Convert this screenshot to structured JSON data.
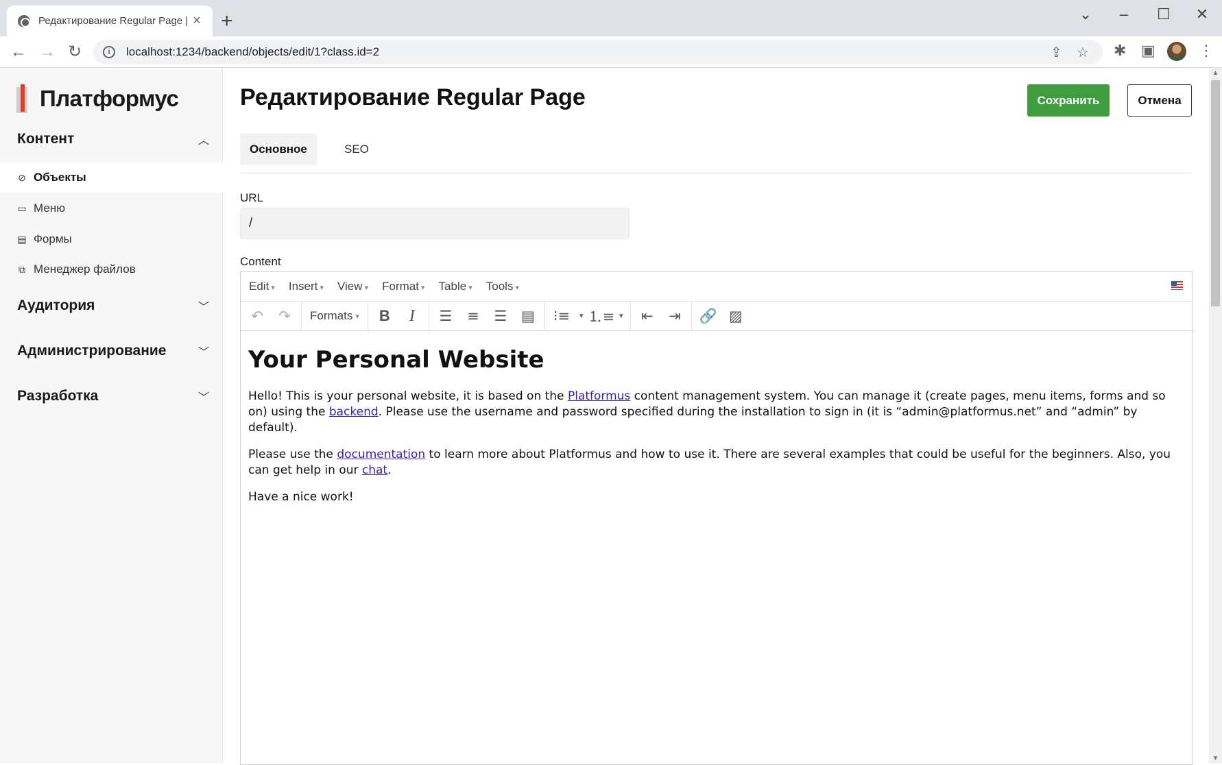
{
  "browser": {
    "tab_title": "Редактирование Regular Page | Пл",
    "url": "localhost:1234/backend/objects/edit/1?class.id=2"
  },
  "sidebar": {
    "logo_text": "Платформус",
    "sections": [
      {
        "label": "Контент",
        "expanded": true
      },
      {
        "label": "Аудитория",
        "expanded": false
      },
      {
        "label": "Администрирование",
        "expanded": false
      },
      {
        "label": "Разработка",
        "expanded": false
      }
    ],
    "content_items": [
      {
        "label": "Объекты",
        "icon": "tag-icon",
        "active": true
      },
      {
        "label": "Меню",
        "icon": "menu-icon",
        "active": false
      },
      {
        "label": "Формы",
        "icon": "form-icon",
        "active": false
      },
      {
        "label": "Менеджер файлов",
        "icon": "files-icon",
        "active": false
      }
    ]
  },
  "main": {
    "title": "Редактирование Regular Page",
    "save_label": "Сохранить",
    "cancel_label": "Отмена",
    "tabs": [
      {
        "label": "Основное",
        "active": true
      },
      {
        "label": "SEO",
        "active": false
      }
    ],
    "url_label": "URL",
    "url_value": "/",
    "content_label": "Content"
  },
  "editor": {
    "menu": [
      "Edit",
      "Insert",
      "View",
      "Format",
      "Table",
      "Tools"
    ],
    "formats_label": "Formats",
    "heading": "Your Personal Website",
    "p1_a": "Hello! This is your personal website, it is based on the ",
    "p1_link1": "Platformus",
    "p1_b": " content management system. You can manage it (create pages, menu items, forms and so on) using the ",
    "p1_link2": "backend",
    "p1_c": ". Please use the username and password specified during the installation to sign in (it is “admin@platformus.net” and “admin” by default).",
    "p2_a": "Please use the ",
    "p2_link1": "documentation",
    "p2_b": " to learn more about Platformus and how to use it. There are several examples that could be useful for the beginners. Also, you can get help in our ",
    "p2_link2": "chat",
    "p2_c": ".",
    "p3": "Have a nice work!"
  },
  "colors": {
    "save_button": "#3f9c3f",
    "logo_accent": "#e8392a",
    "link": "#3a1fa8"
  }
}
